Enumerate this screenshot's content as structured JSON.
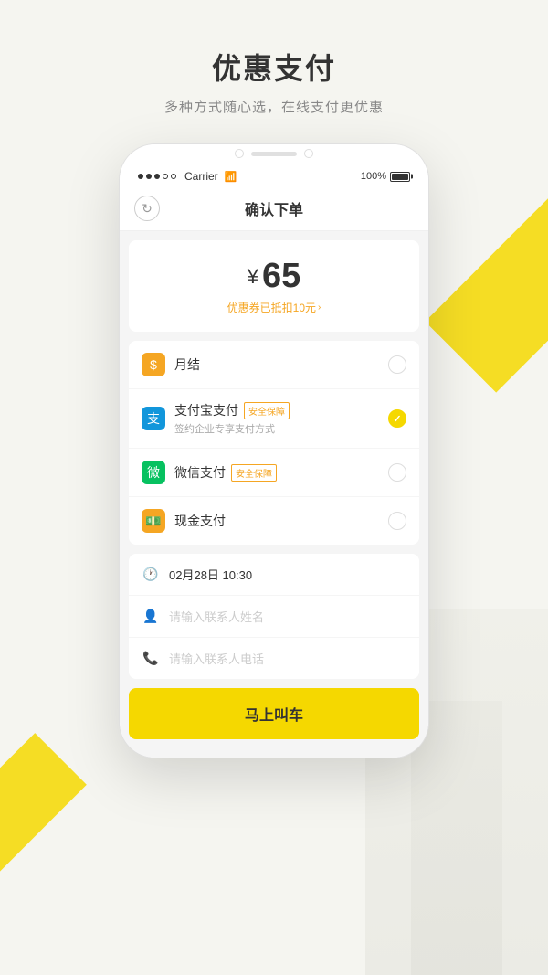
{
  "page": {
    "title": "优惠支付",
    "subtitle": "多种方式随心选，在线支付更优惠"
  },
  "status_bar": {
    "signal_dots": 5,
    "carrier": "Carrier",
    "battery": "100%"
  },
  "nav": {
    "title": "确认下单",
    "back_label": "←"
  },
  "price": {
    "currency": "¥",
    "amount": "65",
    "discount_text": "优惠券已抵扣10元"
  },
  "payment_options": [
    {
      "id": "monthly",
      "name": "月结",
      "sub": "",
      "badge": "",
      "selected": false,
      "icon_type": "monthly"
    },
    {
      "id": "alipay",
      "name": "支付宝支付",
      "sub": "签约企业专享支付方式",
      "badge": "安全保障",
      "selected": true,
      "icon_type": "alipay"
    },
    {
      "id": "wechat",
      "name": "微信支付",
      "sub": "",
      "badge": "安全保障",
      "selected": false,
      "icon_type": "wechat"
    },
    {
      "id": "cash",
      "name": "现金支付",
      "sub": "",
      "badge": "",
      "selected": false,
      "icon_type": "cash"
    }
  ],
  "info_rows": [
    {
      "icon": "🕐",
      "value": "02月28日 10:30",
      "is_placeholder": false
    },
    {
      "icon": "👤",
      "value": "请输入联系人姓名",
      "is_placeholder": true
    },
    {
      "icon": "📞",
      "value": "请输入联系人电话",
      "is_placeholder": true
    }
  ],
  "submit": {
    "label": "马上叫车"
  }
}
